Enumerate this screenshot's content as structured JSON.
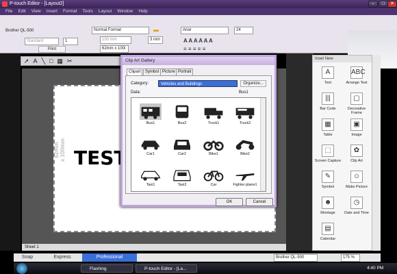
{
  "window": {
    "title": "P-touch Editor - [Layout2]",
    "min": "–",
    "max": "□",
    "close": "✕"
  },
  "menu": [
    "File",
    "Edit",
    "View",
    "Insert",
    "Format",
    "Tools",
    "Layout",
    "Window",
    "Help"
  ],
  "printer": {
    "name": "Brother QL-500",
    "mode": "Standard",
    "copies": "1",
    "print_label": "Print"
  },
  "format": {
    "style": "Normal Format",
    "length": "100 mm",
    "margin": "3 mm",
    "size": "62mm x 100i"
  },
  "font": {
    "name": "Arial",
    "size": "24"
  },
  "canvas": {
    "side_label": "62mm\nx 100mm",
    "text": "TEST",
    "sheet_tab": "Sheet 1"
  },
  "dialog": {
    "title": "Clip Art Gallery",
    "tabs": [
      "Clipart",
      "Symbol",
      "Picture",
      "Portrait"
    ],
    "category_label": "Category:",
    "category_value": "Vehicles and Buildings",
    "organize": "Organize...",
    "data_label": "Data:",
    "selected_name": "Bus1",
    "items": [
      {
        "label": "Bus1",
        "icon": "bus-icon"
      },
      {
        "label": "Bus2",
        "icon": "bus-front-icon"
      },
      {
        "label": "Truck1",
        "icon": "truck-icon"
      },
      {
        "label": "Truck2",
        "icon": "fire-truck-icon"
      },
      {
        "label": "Car1",
        "icon": "car-icon"
      },
      {
        "label": "Car2",
        "icon": "car-front-icon"
      },
      {
        "label": "Bike1",
        "icon": "motorbike-icon"
      },
      {
        "label": "Bike2",
        "icon": "scooter-icon"
      },
      {
        "label": "Taxi1",
        "icon": "taxi-icon"
      },
      {
        "label": "Taxi2",
        "icon": "taxi-front-icon"
      },
      {
        "label": "Car",
        "icon": "bicycle-icon"
      },
      {
        "label": "Fighter plane1",
        "icon": "plane-icon"
      }
    ],
    "ok": "OK",
    "cancel": "Cancel"
  },
  "inset": {
    "title": "Inset New",
    "items": [
      {
        "label": "Text",
        "glyph": "A"
      },
      {
        "label": "Arrange Text",
        "glyph": "ABC"
      },
      {
        "label": "Bar Code",
        "glyph": "|||"
      },
      {
        "label": "Decorative Frame",
        "glyph": "▢"
      },
      {
        "label": "Table",
        "glyph": "▦"
      },
      {
        "label": "Image",
        "glyph": "▣"
      },
      {
        "label": "Screen Capture",
        "glyph": "⬚"
      },
      {
        "label": "Clip Art",
        "glyph": "✿"
      },
      {
        "label": "Symbol",
        "glyph": "✎"
      },
      {
        "label": "Make Picture",
        "glyph": "☺"
      },
      {
        "label": "Montage",
        "glyph": "☻"
      },
      {
        "label": "Date and Time",
        "glyph": "◷"
      },
      {
        "label": "Calendar",
        "glyph": "▤"
      }
    ]
  },
  "modes": [
    "Snap",
    "Express",
    "Professional"
  ],
  "status": {
    "printer": "Brother QL-500",
    "zoom": "175 %"
  },
  "taskbar": {
    "items": [
      "Flashing",
      "P-touch Editor - [La..."
    ],
    "clock": "4:40 PM"
  },
  "colors": {
    "title": "#4d3470",
    "accent": "#3a6fd8"
  }
}
